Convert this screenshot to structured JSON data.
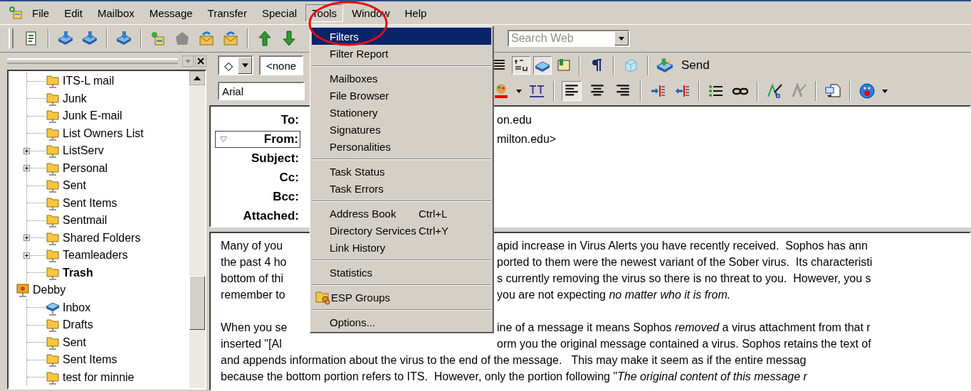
{
  "menu_bar": [
    {
      "label": "File",
      "selected": false
    },
    {
      "label": "Edit",
      "selected": false
    },
    {
      "label": "Mailbox",
      "selected": false
    },
    {
      "label": "Message",
      "selected": false
    },
    {
      "label": "Transfer",
      "selected": false
    },
    {
      "label": "Special",
      "selected": false
    },
    {
      "label": "Tools",
      "selected": true
    },
    {
      "label": "Window",
      "selected": false
    },
    {
      "label": "Help",
      "selected": false
    }
  ],
  "search": {
    "placeholder": "Search Web"
  },
  "tools_menu": {
    "groups": [
      [
        {
          "label": "Filters",
          "kind": "plain",
          "selected": true
        },
        {
          "label": "Filter Report",
          "kind": "plain",
          "selected": false
        }
      ],
      [
        {
          "label": "Mailboxes",
          "kind": "plain",
          "selected": false
        },
        {
          "label": "File Browser",
          "kind": "plain",
          "selected": false
        },
        {
          "label": "Stationery",
          "kind": "plain",
          "selected": false
        },
        {
          "label": "Signatures",
          "kind": "plain",
          "selected": false
        },
        {
          "label": "Personalities",
          "kind": "plain",
          "selected": false
        }
      ],
      [
        {
          "label": "Task Status",
          "kind": "plain",
          "selected": false
        },
        {
          "label": "Task Errors",
          "kind": "plain",
          "selected": false
        }
      ],
      [
        {
          "label": "Address Book",
          "shortcut": "Ctrl+L",
          "kind": "plain",
          "selected": false
        },
        {
          "label": "Directory Services",
          "shortcut": "Ctrl+Y",
          "kind": "plain",
          "selected": false
        },
        {
          "label": "Link History",
          "kind": "plain",
          "selected": false
        }
      ],
      [
        {
          "label": "Statistics",
          "kind": "plain",
          "selected": false
        }
      ],
      [
        {
          "label": "ESP Groups",
          "kind": "with-icon",
          "selected": false
        }
      ],
      [
        {
          "label": "Options...",
          "kind": "plain",
          "selected": false
        }
      ]
    ]
  },
  "tree": [
    {
      "children": [
        {
          "label": "ITS-L mail",
          "kind": "folder",
          "collapsed": false,
          "unread": false
        },
        {
          "label": "Junk",
          "kind": "folder",
          "collapsed": false,
          "unread": false
        },
        {
          "label": "Junk E-mail",
          "kind": "folder",
          "collapsed": false,
          "unread": false
        },
        {
          "label": "List Owners List",
          "kind": "folder",
          "collapsed": false,
          "unread": false
        },
        {
          "label": "ListServ",
          "kind": "folder",
          "collapsed": true,
          "unread": false
        },
        {
          "label": "Personal",
          "kind": "folder",
          "collapsed": true,
          "unread": false
        },
        {
          "label": "Sent",
          "kind": "folder",
          "collapsed": false,
          "unread": false
        },
        {
          "label": "Sent Items",
          "kind": "folder",
          "collapsed": false,
          "unread": false
        },
        {
          "label": "Sentmail",
          "kind": "folder",
          "collapsed": false,
          "unread": false
        },
        {
          "label": "Shared Folders",
          "kind": "folder",
          "collapsed": true,
          "unread": false
        },
        {
          "label": "Teamleaders",
          "kind": "folder",
          "collapsed": true,
          "unread": false
        },
        {
          "label": "Trash",
          "kind": "folder",
          "collapsed": false,
          "unread": true
        }
      ]
    },
    {
      "label": "Debby",
      "kind": "personality",
      "unread": false,
      "children": [
        {
          "label": "Inbox",
          "kind": "inbox",
          "collapsed": false,
          "unread": false
        },
        {
          "label": "Drafts",
          "kind": "folder",
          "collapsed": false,
          "unread": false
        },
        {
          "label": "Sent",
          "kind": "folder",
          "collapsed": false,
          "unread": false
        },
        {
          "label": "Sent Items",
          "kind": "folder",
          "collapsed": false,
          "unread": false
        },
        {
          "label": "test for minnie",
          "kind": "folder",
          "collapsed": false,
          "unread": false
        }
      ]
    }
  ],
  "composer": {
    "priority": "◇",
    "label_dropdown": "<none",
    "toggles": [
      {
        "on": false
      },
      {
        "on": true
      },
      {
        "on": true
      },
      {
        "on": false
      }
    ],
    "send_button": "Send",
    "font": "Arial",
    "alignment_buttons": [
      {
        "selected": true
      },
      {
        "selected": false
      },
      {
        "selected": false
      }
    ],
    "headers": [
      {
        "label": "To:",
        "value": "on.edu"
      },
      {
        "label": "From:",
        "value": "milton.edu>"
      },
      {
        "label": "Subject:"
      },
      {
        "label": "Cc:"
      },
      {
        "label": "Bcc:"
      },
      {
        "label": "Attached:"
      }
    ],
    "body": [
      [
        {
          "kind": "split",
          "left": "Many of you",
          "right": "apid increase in Virus Alerts you have recently received.  Sophos has ann"
        },
        {
          "kind": "split",
          "left": "the past 4 ho",
          "right": "ported to them were the newest variant of the Sober virus.  Its characteristi"
        },
        {
          "kind": "split",
          "left": "bottom of thi",
          "right": "s currently removing the virus so there is no threat to you.  However, you s"
        },
        {
          "kind": "split",
          "left": "remember to",
          "right": "you are not expecting *no matter who it is from.*"
        }
      ],
      [
        {
          "kind": "split",
          "left": "When you se",
          "right": "ine of a message it means Sophos *removed* a virus attachment from that r"
        },
        {
          "kind": "split",
          "left": "inserted \"[Al",
          "right": "orm you the original message contained a virus. Sophos retains the text of"
        },
        {
          "kind": "full",
          "text": "and appends information about the virus to the end of the message.   This may make it seem as if the entire messag"
        },
        {
          "kind": "full",
          "text": "because the bottom portion refers to ITS.  However, only the portion following \"*The original content of this message r*"
        }
      ]
    ]
  }
}
